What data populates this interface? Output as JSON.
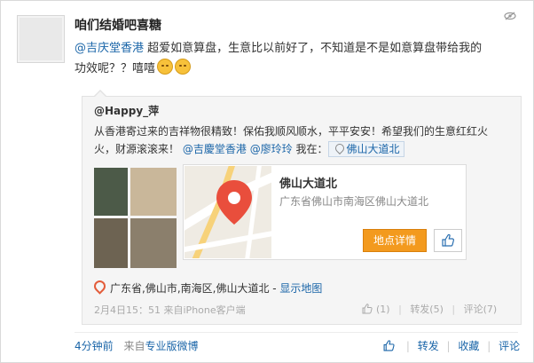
{
  "post": {
    "author": "咱们结婚吧喜糖",
    "mention": "@吉庆堂香港",
    "text_line1": "超爱如意算盘，生意比以前好了，不知道是不是如意算盘带给我的",
    "text_line2": "功效呢？？嘻嘻",
    "emoji": [
      "smile-icon",
      "smile-icon"
    ]
  },
  "repost": {
    "author": "@Happy_萍",
    "text_line1": "从香港寄过来的吉祥物很精致！保佑我顺风顺水，平平安安！希望我们的生意红红火",
    "text_line2_prefix": "火，财源滚滚来！",
    "mention1": "@吉慶堂香港",
    "mention2": "@廖玲玲",
    "at_label": "我在：",
    "location_tag": "佛山大道北",
    "place_card": {
      "title": "佛山大道北",
      "address": "广东省佛山市南海区佛山大道北",
      "detail_button": "地点详情"
    },
    "location_line": "广东省,佛山市,南海区,佛山大道北 -",
    "show_map": "显示地图",
    "time": "2月4日15：51",
    "source_prefix": "来自",
    "source": "iPhone客户端",
    "likes": "(1)",
    "reposts": "转发(5)",
    "comments": "评论(7)"
  },
  "footer": {
    "time": "4分钟前",
    "source_prefix": "来自",
    "source": "专业版微博",
    "repost": "转发",
    "favorite": "收藏",
    "comment": "评论"
  },
  "colors": {
    "link": "#1a65a8",
    "accent": "#f39a1e",
    "pin": "#e94e3c"
  }
}
